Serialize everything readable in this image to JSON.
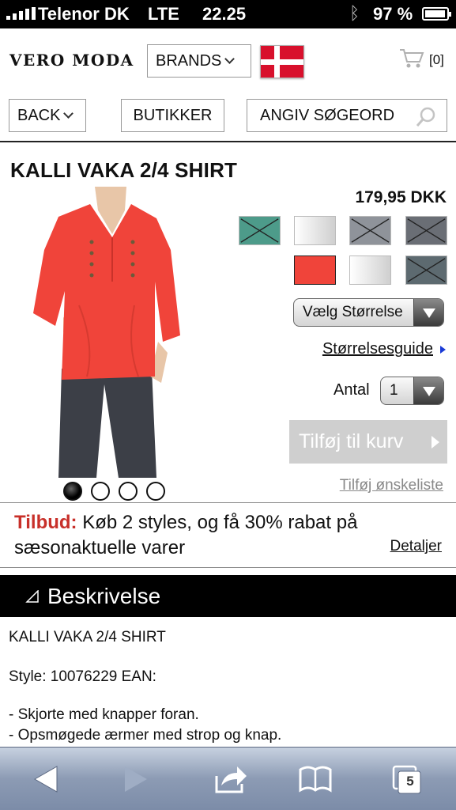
{
  "status_bar": {
    "carrier": "Telenor DK",
    "network": "LTE",
    "time": "22.25",
    "battery_percent": "97 %",
    "battery_level": 0.97,
    "signal_bars": 5,
    "bluetooth_icon": "bluetooth-icon"
  },
  "header": {
    "logo": "VERO MODA",
    "brands_label": "BRANDS",
    "cart_count": "[0]",
    "flag": "denmark-flag"
  },
  "nav": {
    "back_label": "BACK",
    "stores_label": "BUTIKKER",
    "search_placeholder": "ANGIV SØGEORD"
  },
  "product": {
    "title": "KALLI VAKA 2/4 SHIRT",
    "price": "179,95 DKK",
    "image_count": 4,
    "active_image": 0,
    "swatches": [
      {
        "name": "teal",
        "selected": false
      },
      {
        "name": "white",
        "selected": false
      },
      {
        "name": "gray",
        "selected": false
      },
      {
        "name": "dark-gray",
        "selected": false
      },
      {
        "name": "red",
        "selected": true
      },
      {
        "name": "cream-print",
        "selected": false
      },
      {
        "name": "slate",
        "selected": false
      }
    ],
    "size_select": "Vælg Størrelse",
    "size_guide": "Størrelsesguide",
    "qty_label": "Antal",
    "qty_value": "1",
    "add_to_cart": "Tilføj til kurv",
    "add_to_wishlist": "Tilføj ønskeliste"
  },
  "promo": {
    "highlight": "Tilbud:",
    "text": " Køb 2 styles, og få 30% rabat på sæsonaktuelle varer",
    "details_link": "Detaljer"
  },
  "description": {
    "header": "Beskrivelse",
    "lines": [
      "KALLI VAKA 2/4 SHIRT",
      "Style: 10076229 EAN:",
      "- Skjorte med knapper foran.",
      "- Opsmøgede ærmer med strop og knap."
    ]
  },
  "toolbar": {
    "tabs_count": "5",
    "icons": [
      "back-arrow-icon",
      "forward-arrow-icon",
      "share-icon",
      "bookmarks-icon",
      "tabs-icon"
    ]
  },
  "colors": {
    "accent_red": "#c8302a",
    "shirt_red": "#f0443a",
    "flag_red": "#d8102c",
    "link_blue": "#1a3ad6"
  }
}
